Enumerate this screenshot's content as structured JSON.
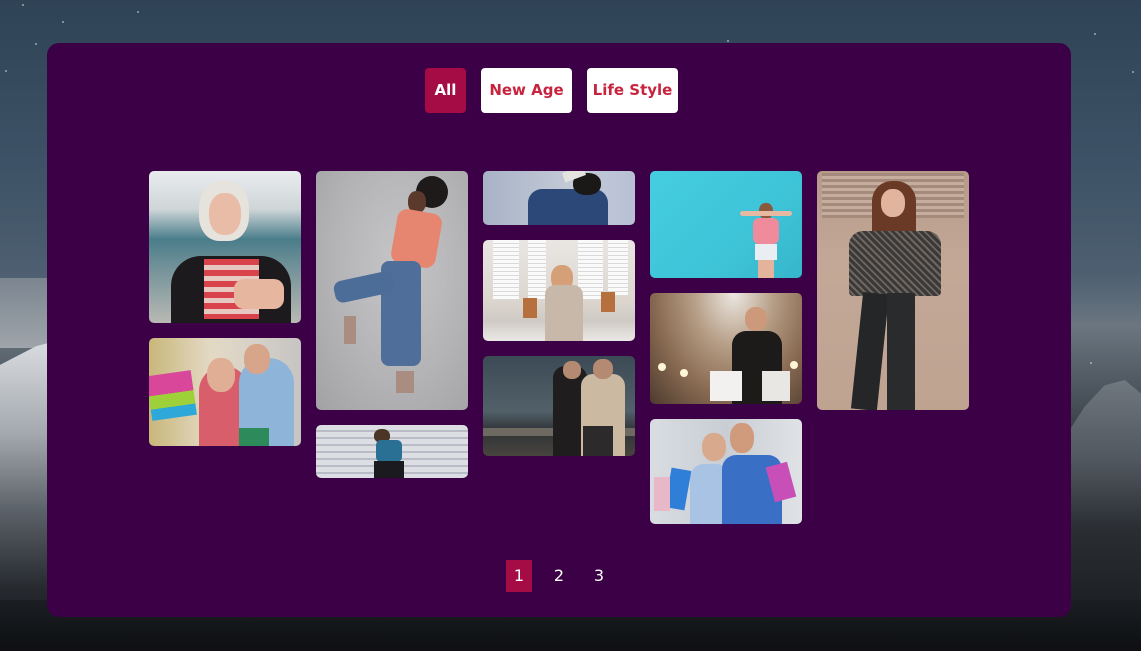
{
  "filters": {
    "items": [
      {
        "label": "All",
        "active": true
      },
      {
        "label": "New Age",
        "active": false
      },
      {
        "label": "Life Style",
        "active": false
      }
    ]
  },
  "gallery": {
    "photos": [
      {
        "subject": "Blonde woman smiling holding smartphone",
        "column": 1
      },
      {
        "subject": "Couple with shopping bags looking at phone",
        "column": 1
      },
      {
        "subject": "Woman in coral shirt and jeans dancing",
        "column": 2
      },
      {
        "subject": "Woman in denim jacket against striped wall",
        "column": 2
      },
      {
        "subject": "Man in denim jacket with book on head",
        "column": 3
      },
      {
        "subject": "Woman using phone by white shuttered building",
        "column": 3
      },
      {
        "subject": "Couple in sunglasses posing by river at dusk",
        "column": 3
      },
      {
        "subject": "Woman in pink top against turquoise wall",
        "column": 4
      },
      {
        "subject": "Woman in sunglasses with shopping bags in gallery",
        "column": 4
      },
      {
        "subject": "Smiling couple holding shopping bags",
        "column": 4
      },
      {
        "subject": "Woman in plaid shirt leaning against wooden door",
        "column": 5
      }
    ]
  },
  "pagination": {
    "pages": [
      "1",
      "2",
      "3"
    ],
    "current": "1"
  },
  "colors": {
    "panel_bg": "#3b0046",
    "accent": "#a50c45",
    "filter_text": "#c8233f"
  }
}
